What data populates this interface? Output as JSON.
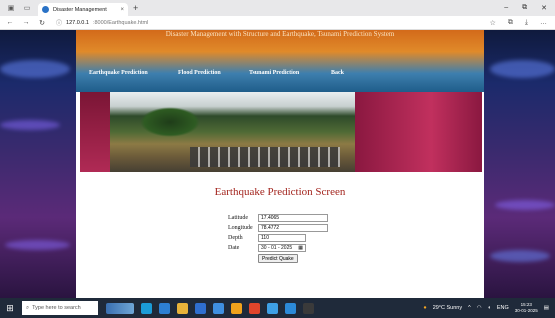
{
  "browser": {
    "tab_title": "Disaster Management",
    "tab_close": "×",
    "new_tab": "+",
    "url_host": "127.0.0.1",
    "url_path": ":8000/Earthquake.html",
    "minimize": "–",
    "maximize": "⧉",
    "close": "✕"
  },
  "site": {
    "title": "Disaster Management with Structure and Earthquake, Tsunami Prediction System",
    "menu": [
      "Earthquake Prediction",
      "Flood Prediction",
      "Tsunami Prediction",
      "Back"
    ]
  },
  "main": {
    "heading": "Earthquake Prediction Screen",
    "form": {
      "latitude_label": "Latitude",
      "latitude_value": "17.4065",
      "longitude_label": "Longitude",
      "longitude_value": "78.4772",
      "depth_label": "Depth",
      "depth_value": "110",
      "date_label": "Date",
      "date_value": "30 - 01 - 2025",
      "submit_label": "Predict Quake"
    }
  },
  "taskbar": {
    "search_placeholder": "Type here to search",
    "weather": "29°C Sunny",
    "lang": "ENG",
    "time": "15:23",
    "date": "30-01-2025"
  },
  "colors": {
    "heading": "#a3251e",
    "menu_text": "#ffffff"
  }
}
